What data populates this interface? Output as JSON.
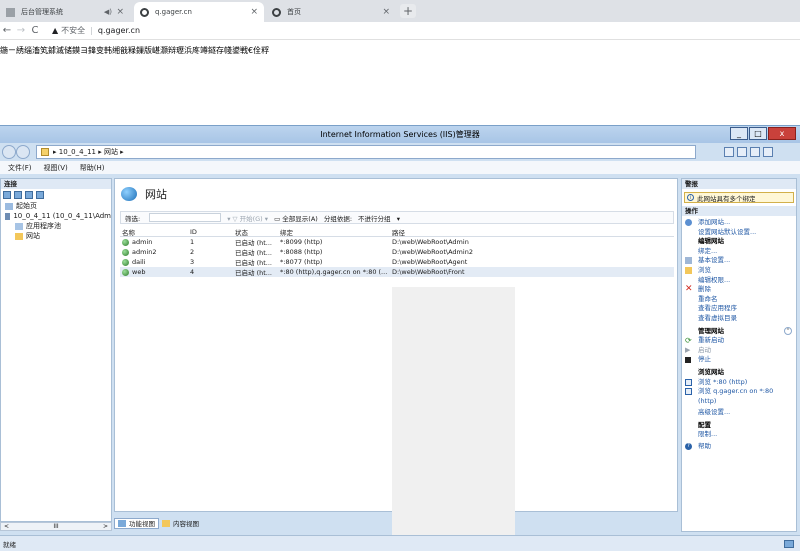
{
  "browser": {
    "tabs": [
      {
        "title": "后台管理系统",
        "active": false
      },
      {
        "title": "q.gager.cn",
        "active": true
      },
      {
        "title": "首页",
        "active": false
      }
    ],
    "address": {
      "warning": "不安全",
      "url": "q.gager.cn"
    }
  },
  "page": {
    "garbled_text": "鍦ㄧ綉缁滀笂鎼滅储鏌ヨ鍏变韩缃戠粶鏁版嵁灏辩瓑浜庝竴鐩存帴鍙戦€佺粰"
  },
  "iis": {
    "title": "Internet Information Services (IIS)管理器",
    "breadcrumb": [
      "10_0_4_11",
      "网站"
    ],
    "menu": [
      "文件(F)",
      "视图(V)",
      "帮助(H)"
    ],
    "connections": {
      "header": "连接",
      "tree": [
        {
          "label": "起始页",
          "level": 1
        },
        {
          "label": "10_0_4_11 (10_0_4_11\\Adm",
          "level": 1
        },
        {
          "label": "应用程序池",
          "level": 2
        },
        {
          "label": "网站",
          "level": 2
        }
      ]
    },
    "center": {
      "title": "网站",
      "filter_label": "筛选:",
      "start_label": "开始(G)",
      "show_all_label": "全部显示(A)",
      "group_label": "分组依据:",
      "group_value": "不进行分组",
      "columns": [
        "名称",
        "ID",
        "状态",
        "绑定",
        "路径"
      ],
      "rows": [
        {
          "name": "admin",
          "id": "1",
          "status": "已启动 (ht...",
          "binding": "*:8099 (http)",
          "path": "D:\\web\\WebRoot\\Admin"
        },
        {
          "name": "admin2",
          "id": "2",
          "status": "已启动 (ht...",
          "binding": "*:8088 (http)",
          "path": "D:\\web\\WebRoot\\Admin2"
        },
        {
          "name": "daili",
          "id": "3",
          "status": "已启动 (ht...",
          "binding": "*:8077 (http)",
          "path": "D:\\web\\WebRoot\\Agent"
        },
        {
          "name": "web",
          "id": "4",
          "status": "已启动 (ht...",
          "binding": "*:80 (http),q.gager.cn on *:80 (...",
          "path": "D:\\web\\WebRoot\\Front"
        }
      ],
      "bottom_tabs": [
        "功能视图",
        "内容视图"
      ]
    },
    "actions": {
      "alerts_header": "警报",
      "alert_text": "此网站具有多个绑定",
      "actions_header": "操作",
      "items": [
        {
          "label": "添加网站...",
          "kind": "link",
          "icon": "add-site-icon"
        },
        {
          "label": "设置网站默认设置...",
          "kind": "link",
          "icon": ""
        },
        {
          "label": "编辑网站",
          "kind": "head",
          "icon": ""
        },
        {
          "label": "绑定...",
          "kind": "link",
          "icon": ""
        },
        {
          "label": "基本设置...",
          "kind": "link",
          "icon": "settings-icon"
        },
        {
          "label": "浏览",
          "kind": "link",
          "icon": "folder-icon"
        },
        {
          "label": "编辑权限...",
          "kind": "link",
          "icon": ""
        },
        {
          "label": "删除",
          "kind": "link",
          "icon": "delete-icon"
        },
        {
          "label": "重命名",
          "kind": "link",
          "icon": ""
        },
        {
          "label": "查看应用程序",
          "kind": "link",
          "icon": ""
        },
        {
          "label": "查看虚拟目录",
          "kind": "link",
          "icon": ""
        }
      ],
      "manage_header": "管理网站",
      "manage_items": [
        {
          "label": "重新启动",
          "kind": "link",
          "icon": "restart-icon"
        },
        {
          "label": "启动",
          "kind": "dim",
          "icon": "start-icon"
        },
        {
          "label": "停止",
          "kind": "link",
          "icon": "stop-icon"
        }
      ],
      "browse_header": "浏览网站",
      "browse_items": [
        {
          "label": "浏览 *:80 (http)",
          "icon": "browse-icon"
        },
        {
          "label": "浏览 q.gager.cn on *:80",
          "icon": "browse-icon"
        },
        {
          "label": "(http)",
          "icon": ""
        }
      ],
      "advanced": "高级设置...",
      "config_header": "配置",
      "limits": "限制...",
      "help": "帮助"
    },
    "status": "就绪"
  }
}
